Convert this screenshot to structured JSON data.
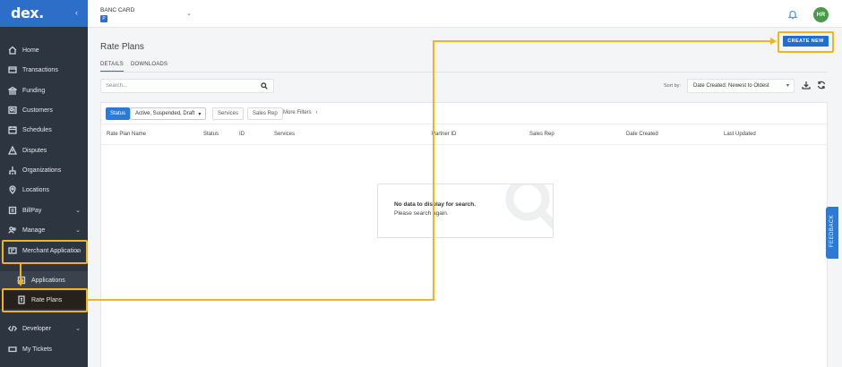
{
  "brand": {
    "logo_text": "dex.",
    "collapse_icon": "chevron-left-icon"
  },
  "header": {
    "account_name": "BANC CARD",
    "account_badge": "P",
    "account_chevron": "⌄",
    "user_initials": "HR",
    "avatar_color": "#4b9a4a"
  },
  "sidebar": {
    "items": [
      {
        "label": "Home",
        "icon": "home-icon"
      },
      {
        "label": "Transactions",
        "icon": "transactions-icon"
      },
      {
        "label": "Funding",
        "icon": "bank-icon"
      },
      {
        "label": "Customers",
        "icon": "customers-icon"
      },
      {
        "label": "Schedules",
        "icon": "calendar-icon"
      },
      {
        "label": "Disputes",
        "icon": "warning-icon"
      },
      {
        "label": "Organizations",
        "icon": "organization-icon"
      },
      {
        "label": "Locations",
        "icon": "location-pin-icon"
      },
      {
        "label": "BillPay",
        "icon": "billpay-icon"
      },
      {
        "label": "Manage",
        "icon": "users-icon"
      },
      {
        "label": "Merchant Application",
        "icon": "application-icon"
      },
      {
        "label": "Applications",
        "icon": "document-icon"
      },
      {
        "label": "Rate Plans",
        "icon": "rate-plan-icon"
      },
      {
        "label": "Developer",
        "icon": "code-icon"
      },
      {
        "label": "My Tickets",
        "icon": "ticket-icon"
      }
    ]
  },
  "page": {
    "title": "Rate Plans",
    "tabs": [
      {
        "label": "DETAILS",
        "active": true
      },
      {
        "label": "DOWNLOADS",
        "active": false
      }
    ],
    "create_button": "CREATE NEW",
    "search_placeholder": "Search...",
    "sort_label": "Sort by:",
    "sort_value": "Date Created: Newest to Oldest"
  },
  "filters": {
    "status_label": "Status",
    "status_value": "Active, Suspended, Draft",
    "services": "Services",
    "sales_rep": "Sales Rep",
    "more_filters": "More Filters"
  },
  "table": {
    "columns": [
      "Rate Plan Name",
      "Status",
      "ID",
      "Services",
      "Partner ID",
      "Sales Rep",
      "Date Created",
      "Last Updated"
    ]
  },
  "empty_state": {
    "line1": "No data to display for search.",
    "line2": "Please search again."
  },
  "feedback_tab": "FEEDBACK",
  "colors": {
    "sidebar": "#2d3540",
    "brand_blue": "#2d6ec9",
    "highlight": "#f2b41b",
    "primary_button": "#1f6fd1"
  }
}
